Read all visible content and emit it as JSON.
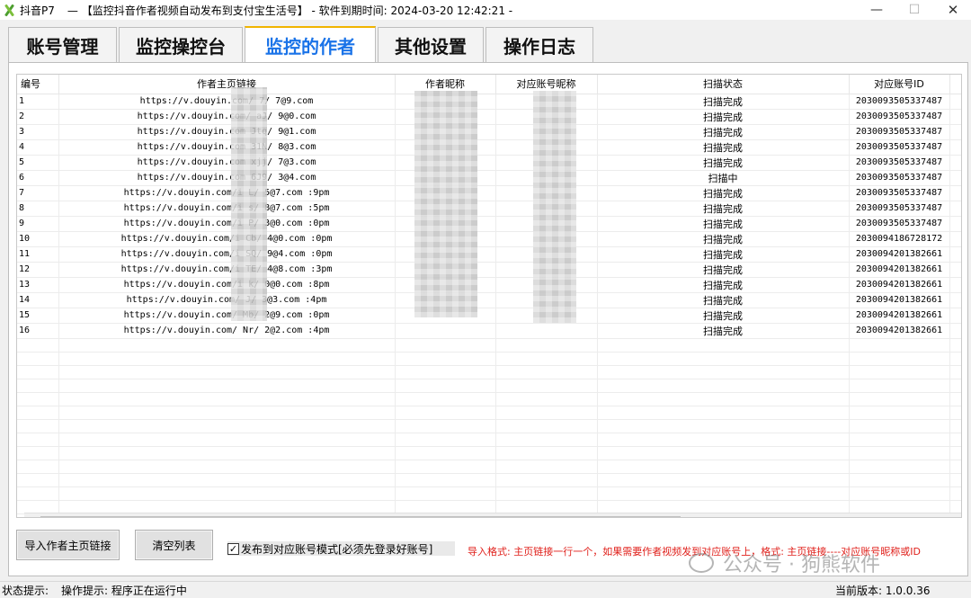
{
  "window": {
    "app_name": "抖音P7",
    "title": "—  【监控抖音作者视频自动发布到支付宝生活号】 - 软件到期时间: 2024-03-20 12:42:21 -",
    "minimize": "—",
    "maximize": "☐",
    "close": "✕"
  },
  "tabs": [
    {
      "label": "账号管理",
      "active": false
    },
    {
      "label": "监控操控台",
      "active": false
    },
    {
      "label": "监控的作者",
      "active": true
    },
    {
      "label": "其他设置",
      "active": false
    },
    {
      "label": "操作日志",
      "active": false
    }
  ],
  "table": {
    "columns": [
      "编号",
      "作者主页链接",
      "作者昵称",
      "对应账号昵称",
      "扫描状态",
      "对应账号ID"
    ],
    "rows": [
      {
        "idx": "1",
        "url": "https://v.douyin.com/ 7/ 7@9.com",
        "nick": "",
        "acct": "",
        "status": "扫描完成",
        "id": "2030093505337487"
      },
      {
        "idx": "2",
        "url": "https://v.douyin.com/ aJ/ 9@0.com",
        "nick": "",
        "acct": "",
        "status": "扫描完成",
        "id": "2030093505337487"
      },
      {
        "idx": "3",
        "url": "https://v.douyin.com Jtq/ 9@1.com",
        "nick": "",
        "acct": "",
        "status": "扫描完成",
        "id": "2030093505337487"
      },
      {
        "idx": "4",
        "url": "https://v.douyin.com 31N/ 8@3.com",
        "nick": "",
        "acct": "",
        "status": "扫描完成",
        "id": "2030093505337487"
      },
      {
        "idx": "5",
        "url": "https://v.douyin.com xjj/ 7@3.com",
        "nick": "",
        "acct": "",
        "status": "扫描完成",
        "id": "2030093505337487"
      },
      {
        "idx": "6",
        "url": "https://v.douyin.com 6J9/ 3@4.com",
        "nick": "",
        "acct": "",
        "status": "扫描中",
        "id": "2030093505337487"
      },
      {
        "idx": "7",
        "url": "https://v.douyin.com/i L/ 5@7.com :9pm",
        "nick": "",
        "acct": "",
        "status": "扫描完成",
        "id": "2030093505337487"
      },
      {
        "idx": "8",
        "url": "https://v.douyin.com/i s/ 8@7.com :5pm",
        "nick": "",
        "acct": "",
        "status": "扫描完成",
        "id": "2030093505337487"
      },
      {
        "idx": "9",
        "url": "https://v.douyin.com/i P/ 3@0.com :0pm",
        "nick": "",
        "acct": "",
        "status": "扫描完成",
        "id": "2030093505337487"
      },
      {
        "idx": "10",
        "url": "https://v.douyin.com/i Cb/ 4@0.com :0pm",
        "nick": "",
        "acct": "",
        "status": "扫描完成",
        "id": "2030094186728172"
      },
      {
        "idx": "11",
        "url": "https://v.douyin.com/i SQ/ 9@4.com :0pm",
        "nick": "",
        "acct": "",
        "status": "扫描完成",
        "id": "2030094201382661"
      },
      {
        "idx": "12",
        "url": "https://v.douyin.com/i TE/ 4@8.com :3pm",
        "nick": "",
        "acct": "",
        "status": "扫描完成",
        "id": "2030094201382661"
      },
      {
        "idx": "13",
        "url": "https://v.douyin.com/i k/ 0@0.com :8pm",
        "nick": "",
        "acct": "",
        "status": "扫描完成",
        "id": "2030094201382661"
      },
      {
        "idx": "14",
        "url": "https://v.douyin.com/ J/ 3@3.com :4pm",
        "nick": "",
        "acct": "",
        "status": "扫描完成",
        "id": "2030094201382661"
      },
      {
        "idx": "15",
        "url": "https://v.douyin.com/ Mb/ 2@9.com :0pm",
        "nick": "",
        "acct": "",
        "status": "扫描完成",
        "id": "2030094201382661"
      },
      {
        "idx": "16",
        "url": "https://v.douyin.com/ Nr/ 2@2.com :4pm",
        "nick": "",
        "acct": "",
        "status": "扫描完成",
        "id": "2030094201382661"
      }
    ],
    "empty_rows": 14
  },
  "controls": {
    "import_button": "导入作者主页链接",
    "clear_button": "清空列表",
    "publish_mode_checked": true,
    "publish_mode_label": "发布到对应账号模式[必须先登录好账号]",
    "hint": "导入格式: 主页链接一行一个，如果需要作者视频发到对应账号上，格式: 主页链接----对应账号昵称或ID"
  },
  "watermark": "公众号 · 狗熊软件",
  "status_bar": {
    "status_label": "状态提示:",
    "operation_label": "操作提示: 程序正在运行中",
    "version": "当前版本: 1.0.0.36"
  }
}
